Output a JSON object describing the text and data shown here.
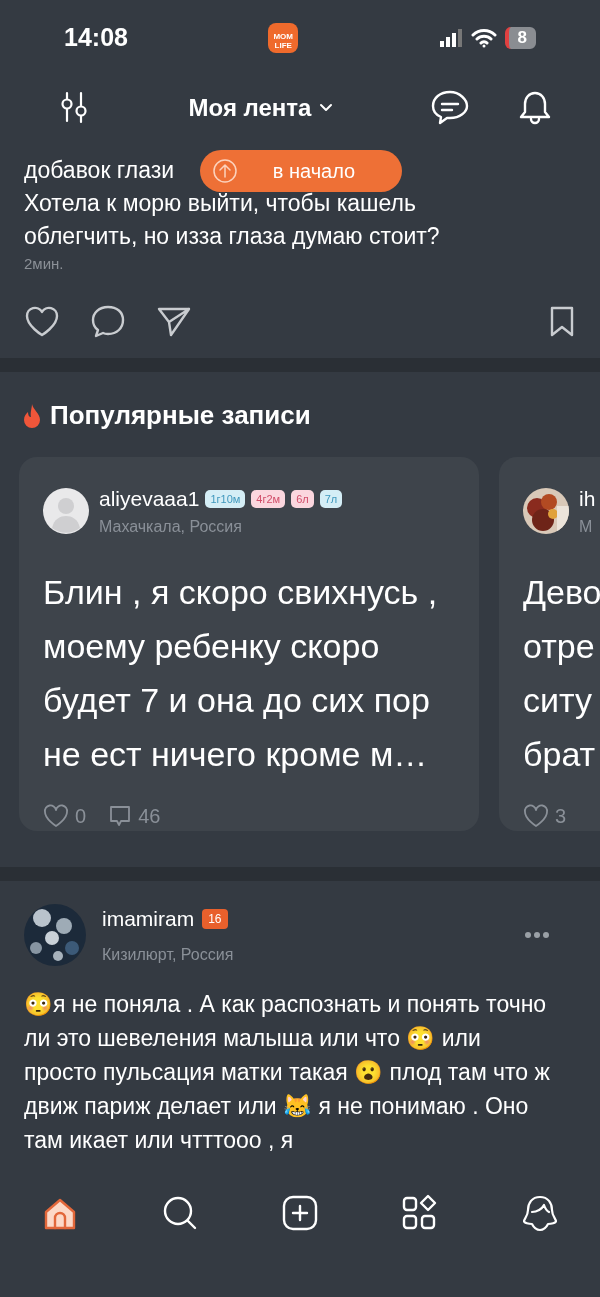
{
  "status_bar": {
    "time": "14:08",
    "app_logo": "MOM LIFE",
    "battery": "8"
  },
  "header": {
    "title": "Моя лента"
  },
  "scroll_top_button": {
    "label": "в начало"
  },
  "top_post": {
    "lines": [
      "добавок глази",
      "Хотела к морю выйти, чтобы кашель облегчить, но изза глаза думаю стоит?"
    ],
    "time": "2мин."
  },
  "popular": {
    "title": "Популярные записи",
    "cards": [
      {
        "kind": "full",
        "author": "aliyevaaa1",
        "location": "Махачкала, Россия",
        "badges": [
          {
            "label": "1г10м",
            "kind": "boy"
          },
          {
            "label": "4г2м",
            "kind": "girl"
          },
          {
            "label": "6л",
            "kind": "girl"
          },
          {
            "label": "7л",
            "kind": "boy"
          }
        ],
        "text": "Блин , я скоро свихнусь , моему ребенку скоро будет 7 и она до сих пор не ест ничего кроме м…",
        "likes": "0",
        "comments": "46"
      },
      {
        "kind": "cut",
        "author": "ih",
        "location": "М",
        "lines": [
          "Дево",
          "отре",
          "ситу",
          "брат"
        ],
        "likes": "3"
      }
    ]
  },
  "post": {
    "author": "imamiram",
    "badge": "16",
    "location": "Кизилюрт, Россия",
    "text": "😳я не поняла . А как распознать и понять точно ли это шевеления малыша или что 😳 или просто пульсация матки такая 😮 плод там что ж движ париж делает или 😹 я не понимаю . Оно там икает или чтттооо , я"
  },
  "tab_bar": [
    {
      "kind": "home",
      "selected": true
    },
    {
      "kind": "search",
      "selected": false
    },
    {
      "kind": "add",
      "selected": false
    },
    {
      "kind": "services",
      "selected": false
    },
    {
      "kind": "profile",
      "selected": false
    }
  ]
}
